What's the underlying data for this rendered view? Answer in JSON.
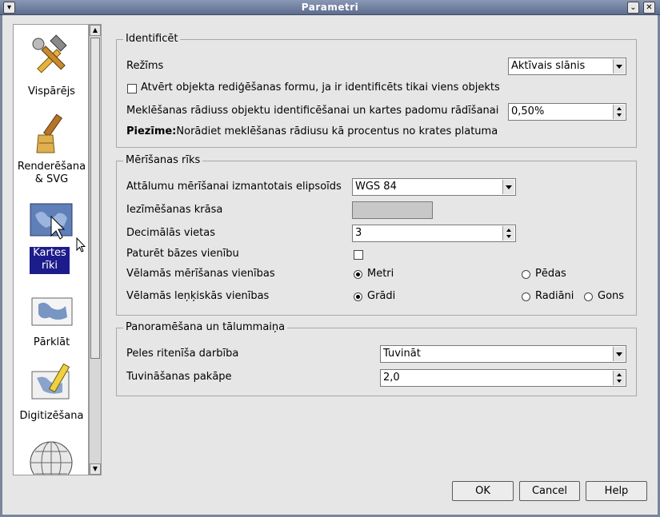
{
  "window": {
    "title": "Parametri",
    "menu_glyph": "▾",
    "shade_glyph": "⌄",
    "close_glyph": "✕"
  },
  "sidebar": {
    "items": [
      {
        "label": "Vispārējs",
        "icon": "tools-icon"
      },
      {
        "label": "Renderēšana & SVG",
        "icon": "paintbrush-icon"
      },
      {
        "label": "Kartes rīki",
        "icon": "map-cursor-icon",
        "selected": true
      },
      {
        "label": "Pārklāt",
        "icon": "overlay-map-icon"
      },
      {
        "label": "Digitizēšana",
        "icon": "digitize-pencil-icon"
      },
      {
        "label": "",
        "icon": "globe-icon"
      }
    ]
  },
  "identify": {
    "legend": "Identificēt",
    "mode_label": "Režīms",
    "mode_value": "Aktīvais slānis",
    "open_form_label": "Atvērt objekta rediģēšanas formu, ja ir identificēts tikai viens objekts",
    "open_form_checked": false,
    "radius_label": "Meklēšanas rādiuss objektu identificēšanai un kartes padomu rādīšanai",
    "radius_value": "0,50%",
    "note_bold": "Piezīme:",
    "note_text": "Norādiet meklēšanas rādiusu kā procentus no krates platuma"
  },
  "measure": {
    "legend": "Mērīšanas rīks",
    "ellipsoid_label": "Attālumu mērīšanai izmantotais elipsoīds",
    "ellipsoid_value": "WGS 84",
    "color_label": "Iezīmēšanas krāsa",
    "color_value": "#c8c8c8",
    "decimals_label": "Decimālās vietas",
    "decimals_value": "3",
    "keep_base_label": "Paturēt bāzes vienību",
    "keep_base_checked": false,
    "units_label": "Vēlamās mērīšanas vienības",
    "units_options": [
      "Metri",
      "Pēdas"
    ],
    "units_selected": "Metri",
    "angle_label": "Vēlamās leņķiskās vienības",
    "angle_options": [
      "Grādi",
      "Radiāni",
      "Gons"
    ],
    "angle_selected": "Grādi"
  },
  "pan_zoom": {
    "legend": "Panoramēšana un tālummaiņa",
    "wheel_label": "Peles ritenīša darbība",
    "wheel_value": "Tuvināt",
    "zoom_factor_label": "Tuvināšanas pakāpe",
    "zoom_factor_value": "2,0"
  },
  "buttons": {
    "ok": "OK",
    "cancel": "Cancel",
    "help": "Help"
  }
}
